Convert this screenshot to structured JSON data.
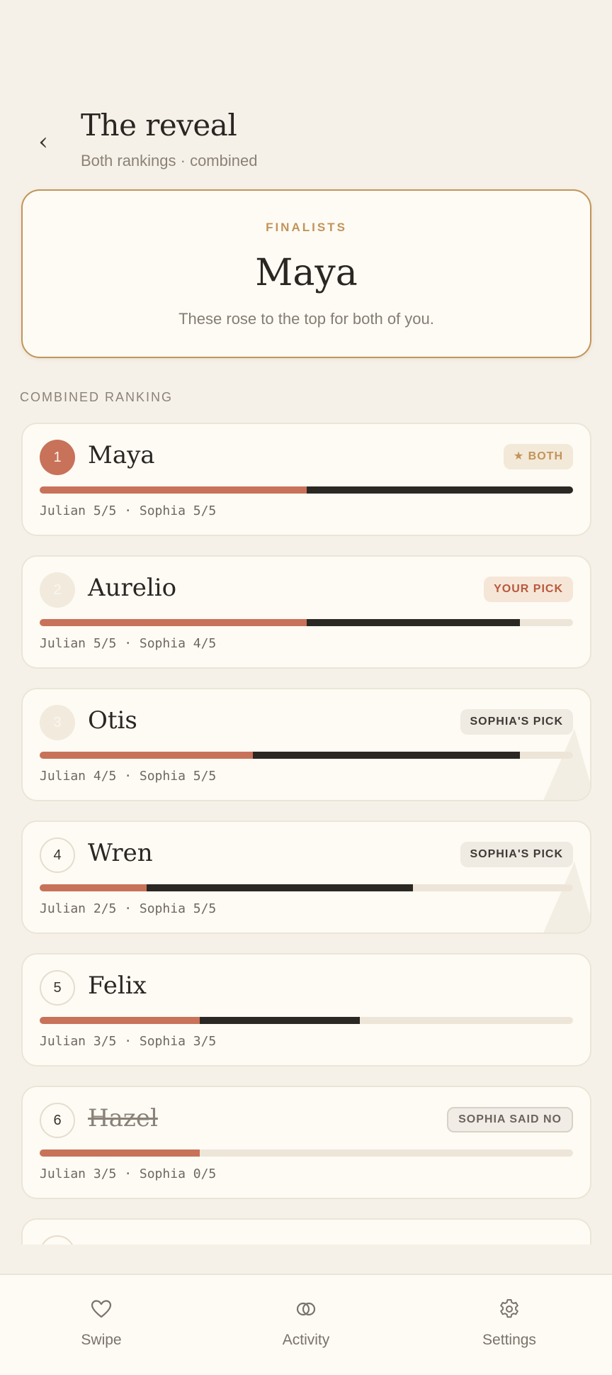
{
  "header": {
    "back_icon": "chevron-left-icon",
    "back_glyph": "‹",
    "title": "The reveal",
    "subtitle": "Both rankings · combined"
  },
  "finalists": {
    "label": "FINALISTS",
    "name": "Maya",
    "note": "These rose to the top for both of you."
  },
  "section_label": "COMBINED RANKING",
  "colors": {
    "accent": "#c2945a",
    "julian": "#c87259",
    "sophia": "#2b2723",
    "background": "#f6f1e8"
  },
  "rankings": [
    {
      "rank": "1",
      "name": "Maya",
      "badge": "★ BOTH",
      "julian": 5,
      "sophia": 5,
      "scores_text": "Julian 5/5 · Sophia 5/5"
    },
    {
      "rank": "2",
      "name": "Aurelio",
      "badge": "YOUR PICK",
      "julian": 5,
      "sophia": 4,
      "scores_text": "Julian 5/5 · Sophia 4/5"
    },
    {
      "rank": "3",
      "name": "Otis",
      "badge": "SOPHIA'S PICK",
      "julian": 4,
      "sophia": 5,
      "scores_text": "Julian 4/5 · Sophia 5/5"
    },
    {
      "rank": "4",
      "name": "Wren",
      "badge": "SOPHIA'S PICK",
      "julian": 2,
      "sophia": 5,
      "scores_text": "Julian 2/5 · Sophia 5/5"
    },
    {
      "rank": "5",
      "name": "Felix",
      "badge": "",
      "julian": 3,
      "sophia": 3,
      "scores_text": "Julian 3/5 · Sophia 3/5"
    },
    {
      "rank": "6",
      "name": "Hazel",
      "badge": "SOPHIA SAID NO",
      "julian": 3,
      "sophia": 0,
      "scores_text": "Julian 3/5 · Sophia 0/5"
    }
  ],
  "tabs": [
    {
      "label": "Swipe",
      "icon": "heart-icon"
    },
    {
      "label": "Activity",
      "icon": "rings-icon"
    },
    {
      "label": "Settings",
      "icon": "gear-icon"
    }
  ]
}
